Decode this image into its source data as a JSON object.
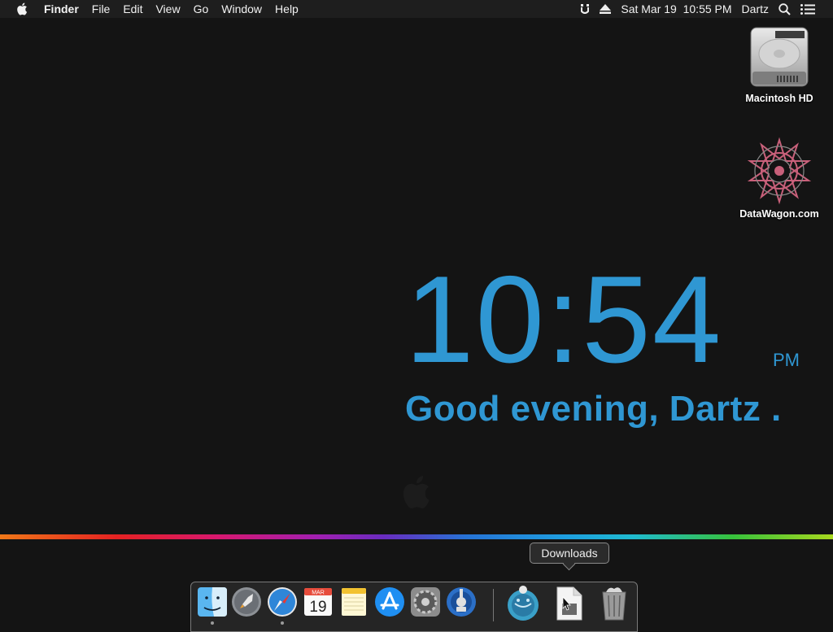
{
  "menubar": {
    "app_name": "Finder",
    "menus": [
      "File",
      "Edit",
      "View",
      "Go",
      "Window",
      "Help"
    ],
    "datetime": "Sat Mar 19  10:55 PM",
    "user": "Dartz"
  },
  "desktop": {
    "icons": [
      {
        "label": "Macintosh HD",
        "icon": "hard-drive-icon"
      },
      {
        "label": "DataWagon.com",
        "icon": "datawagon-star-icon"
      }
    ]
  },
  "widget": {
    "time": "10:54",
    "ampm": "PM",
    "greeting": "Good evening, Dartz ."
  },
  "tooltip": {
    "text": "Downloads"
  },
  "dock": {
    "apps": [
      {
        "name": "finder-icon",
        "running": true
      },
      {
        "name": "launchpad-icon",
        "running": false
      },
      {
        "name": "safari-icon",
        "running": true
      },
      {
        "name": "calendar-icon",
        "running": false,
        "month": "MAR",
        "day": "19"
      },
      {
        "name": "notes-icon",
        "running": false
      },
      {
        "name": "app-store-icon",
        "running": false
      },
      {
        "name": "system-preferences-icon",
        "running": false
      },
      {
        "name": "network-utility-icon",
        "running": false
      }
    ],
    "others": [
      {
        "name": "globe-folder-icon"
      },
      {
        "name": "downloads-stack-icon"
      },
      {
        "name": "trash-icon"
      }
    ]
  },
  "colors": {
    "accent": "#2f97d3",
    "background": "#141414",
    "menubar": "#1e1e1e"
  }
}
